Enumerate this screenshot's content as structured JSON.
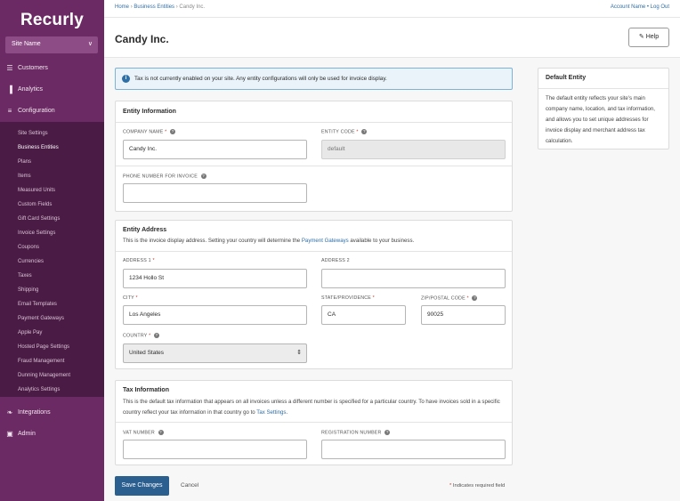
{
  "brand": {
    "logo": "Recurly"
  },
  "site_selector": {
    "value": "Site Name"
  },
  "nav": {
    "main": [
      {
        "label": "Customers",
        "icon": "users-icon"
      },
      {
        "label": "Analytics",
        "icon": "bar-chart-icon"
      },
      {
        "label": "Configuration",
        "icon": "sliders-icon"
      }
    ],
    "sub": [
      "Site Settings",
      "Business Entities",
      "Plans",
      "Items",
      "Measured Units",
      "Custom Fields",
      "Gift Card Settings",
      "Invoice Settings",
      "Coupons",
      "Currencies",
      "Taxes",
      "Shipping",
      "Email Templates",
      "Payment Gateways",
      "Apple Pay",
      "Hosted Page Settings",
      "Fraud Management",
      "Dunning Management",
      "Analytics Settings"
    ],
    "bottom": [
      {
        "label": "Integrations",
        "icon": "plug-icon"
      },
      {
        "label": "Admin",
        "icon": "lock-icon"
      }
    ],
    "active_sub": "Business Entities"
  },
  "breadcrumb": {
    "home": "Home",
    "sep": "›",
    "entities": "Business Entities",
    "current": "Candy Inc."
  },
  "account": {
    "account_name": "Account Name",
    "dot": "•",
    "logout": "Log Out"
  },
  "page": {
    "title": "Candy Inc.",
    "help": "Help"
  },
  "alert": {
    "text": "Tax is not currently enabled on your site. Any entity configurations will only be used for invoice display."
  },
  "entity_info": {
    "title": "Entity Information",
    "company_name_label": "COMPANY NAME",
    "company_name_value": "Candy Inc.",
    "entity_code_label": "ENTITY CODE",
    "entity_code_value": "default",
    "phone_label": "PHONE NUMBER FOR INVOICE",
    "phone_value": ""
  },
  "entity_address": {
    "title": "Entity Address",
    "desc_before": "This is the invoice display address. Setting your country will determine the ",
    "desc_link": "Payment Gateways",
    "desc_after": " available to your business.",
    "address1_label": "ADDRESS 1",
    "address1_value": "1234 Hollo St",
    "address2_label": "ADDRESS 2",
    "address2_value": "",
    "city_label": "CITY",
    "city_value": "Los Angeles",
    "state_label": "STATE/PROVIDENCE",
    "state_value": "CA",
    "zip_label": "ZIP/POSTAL CODE",
    "zip_value": "90025",
    "country_label": "COUNTRY",
    "country_value": "United States"
  },
  "tax_info": {
    "title": "Tax Information",
    "desc_before": "This is the default tax information that appears on all invoices unless a different number is specified for a particular country. To have invoices sold in a specific country reflect your tax information in that country go to ",
    "desc_link": "Tax Settings",
    "desc_after": ".",
    "vat_label": "VAT NUMBER",
    "vat_value": "",
    "reg_label": "REGISTRATION NUMBER",
    "reg_value": ""
  },
  "side_panel": {
    "title": "Default Entity",
    "text": "The default entity reflects your site's main company name, location, and tax information, and allows you to set unique addresses for invoice display and merchant address tax calculation."
  },
  "actions": {
    "save": "Save Changes",
    "cancel": "Cancel",
    "required_note": "Indicates required field",
    "asterisk": "*"
  }
}
